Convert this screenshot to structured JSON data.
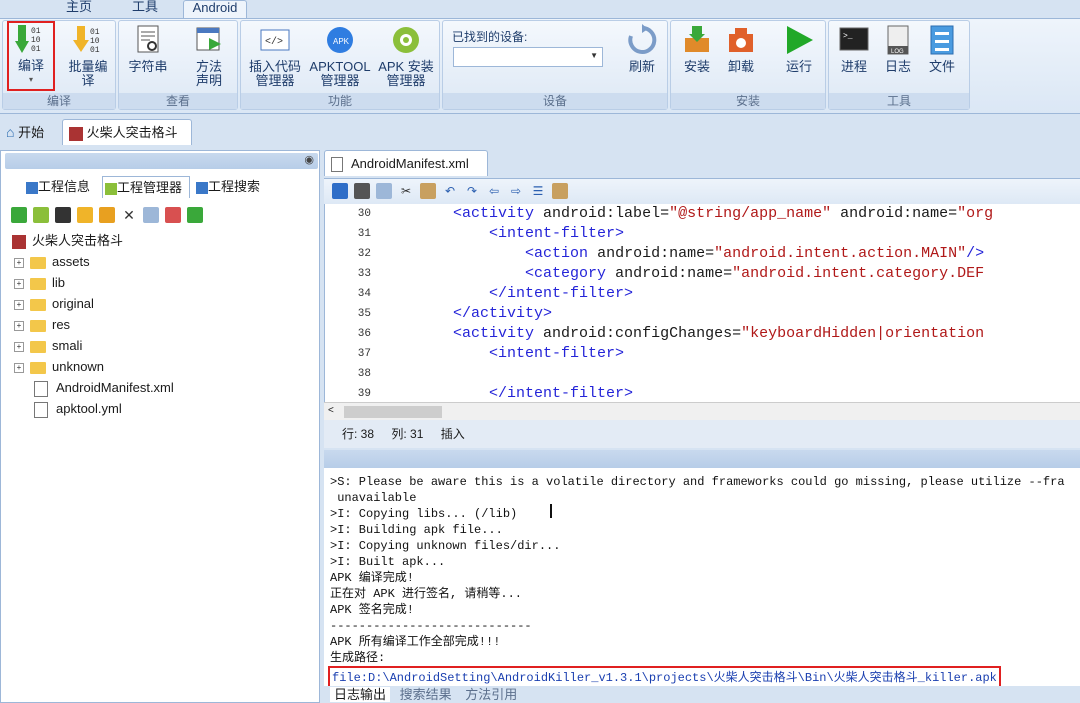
{
  "ribbon": {
    "tabs": [
      "主页",
      "工具",
      "Android"
    ],
    "groups": {
      "compile": "编译",
      "view": "查看",
      "features": "功能",
      "device": "设备",
      "install": "安装",
      "tools": "工具"
    },
    "buttons": {
      "compile": "编译",
      "batch_compile": "批量编译",
      "strings": "字符串",
      "method_decl": "方法声明",
      "insert_code": "插入代码管理器",
      "apktool": "APKTOOL管理器",
      "apk_install": "APK 安装管理器",
      "refresh": "刷新",
      "install": "安装",
      "uninstall": "卸载",
      "run": "运行",
      "process": "进程",
      "log": "日志",
      "file": "文件"
    },
    "device_label": "已找到的设备:"
  },
  "doc_tabs": [
    "开始",
    "火柴人突击格斗"
  ],
  "left_panel": {
    "tabs": [
      "工程信息",
      "工程管理器",
      "工程搜索"
    ],
    "root": "火柴人突击格斗",
    "folders": [
      "assets",
      "lib",
      "original",
      "res",
      "smali",
      "unknown"
    ],
    "files": [
      "AndroidManifest.xml",
      "apktool.yml"
    ]
  },
  "editor": {
    "tab": "AndroidManifest.xml",
    "line_numbers": [
      "30",
      "31",
      "32",
      "33",
      "34",
      "35",
      "36",
      "37",
      "38",
      "39"
    ],
    "status": {
      "row": "行: 38",
      "col": "列: 31",
      "mode": "插入"
    }
  },
  "log": {
    "lines": [
      ">S: Please be aware this is a volatile directory and frameworks could go missing, please utilize --fra",
      " unavailable",
      ">I: Copying libs... (/lib)",
      ">I: Building apk file...",
      ">I: Copying unknown files/dir...",
      ">I: Built apk...",
      "APK 编译完成!",
      "正在对 APK 进行签名, 请稍等...",
      "APK 签名完成!",
      "----------------------------",
      "APK 所有编译工作全部完成!!!",
      "生成路径:"
    ],
    "path": "file:D:\\AndroidSetting\\AndroidKiller_v1.3.1\\projects\\火柴人突击格斗\\Bin\\火柴人突击格斗_killer.apk",
    "tabs": [
      "日志输出",
      "搜索结果",
      "方法引用"
    ]
  }
}
